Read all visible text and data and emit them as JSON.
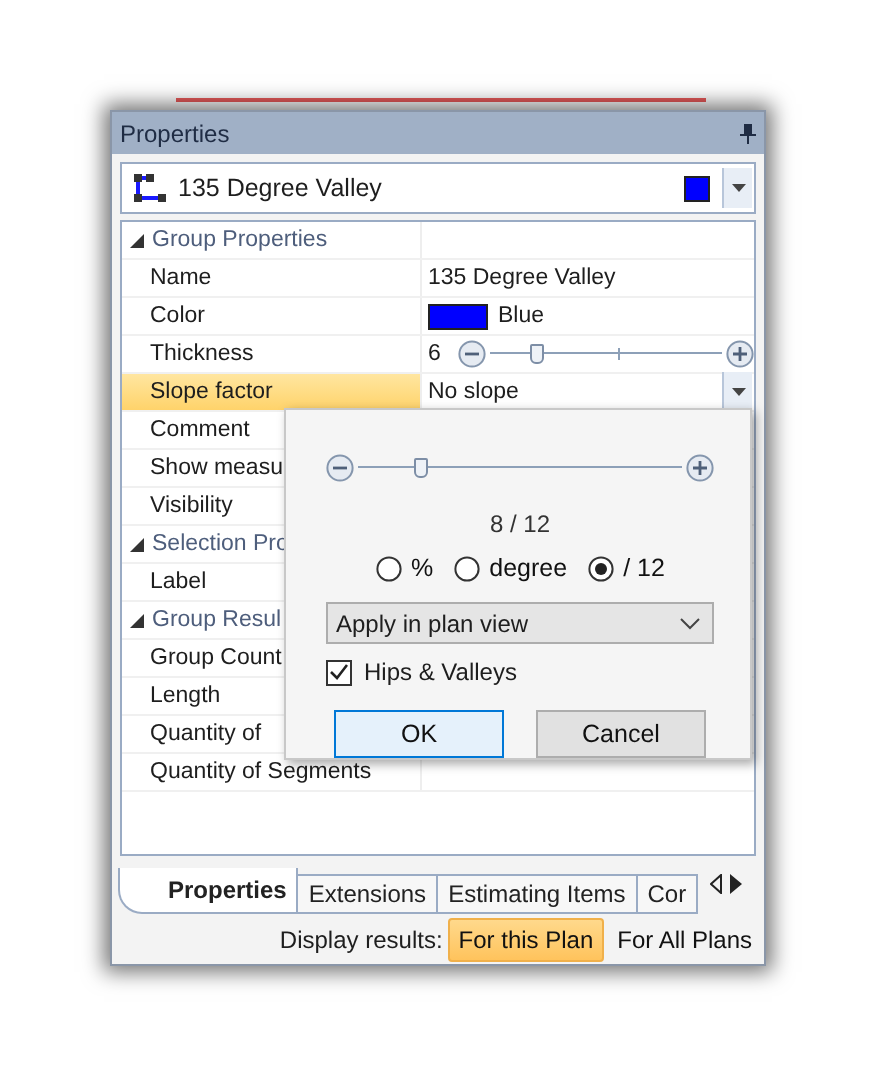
{
  "panel": {
    "title": "Properties"
  },
  "header": {
    "label": "135 Degree Valley",
    "color": "#0000ff"
  },
  "grid": {
    "rows": [
      {
        "kind": "category",
        "label": "Group Properties",
        "expanded": true
      },
      {
        "kind": "text",
        "label": "Name",
        "value": "135 Degree Valley",
        "selected": false
      },
      {
        "kind": "color",
        "label": "Color",
        "value": "Blue",
        "color": "#0000ff",
        "selected": false
      },
      {
        "kind": "slider",
        "label": "Thickness",
        "value": "6",
        "level": 0.2,
        "selected": false
      },
      {
        "kind": "dropdown",
        "label": "Slope factor",
        "value": "No slope",
        "selected": true
      },
      {
        "kind": "text",
        "label": "Comment",
        "selected": false
      },
      {
        "kind": "text",
        "label": "Show measu",
        "selected": false
      },
      {
        "kind": "text",
        "label": "Visibility",
        "selected": false
      },
      {
        "kind": "category",
        "label": "Selection Pro",
        "expanded": true
      },
      {
        "kind": "text",
        "label": "Label",
        "selected": false
      },
      {
        "kind": "category",
        "label": "Group Resul",
        "expanded": true
      },
      {
        "kind": "text",
        "label": "Group Count",
        "selected": false
      },
      {
        "kind": "text",
        "label": "Length",
        "selected": false
      },
      {
        "kind": "text",
        "label": "Quantity of",
        "selected": false
      },
      {
        "kind": "text",
        "label": "Quantity of Segments",
        "selected": false
      }
    ]
  },
  "popup": {
    "level": 0.2,
    "reading": "8 / 12",
    "units": [
      {
        "label": "%",
        "selected": false
      },
      {
        "label": "degree",
        "selected": false
      },
      {
        "label": "/ 12",
        "selected": true
      }
    ],
    "mode": "Apply in plan view",
    "hips": {
      "label": "Hips & Valleys",
      "checked": true
    },
    "buttons": [
      {
        "label": "OK",
        "default": true
      },
      {
        "label": "Cancel",
        "default": false
      }
    ]
  },
  "tabs": [
    {
      "label": "Properties",
      "selected": true
    },
    {
      "label": "Extensions",
      "selected": false
    },
    {
      "label": "Estimating Items",
      "selected": false
    },
    {
      "label": "Cor",
      "selected": false
    }
  ],
  "display": {
    "label": "Display results:",
    "options": [
      {
        "label": "For this Plan",
        "selected": true
      },
      {
        "label": "For All Plans",
        "selected": false
      }
    ]
  }
}
